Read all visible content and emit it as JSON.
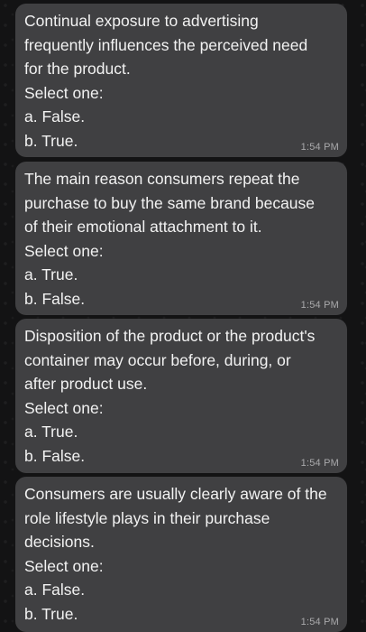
{
  "messages": [
    {
      "question": "Continual exposure to advertising\nfrequently influences the perceived need\nfor the product.",
      "prompt": "Select one:",
      "options": [
        "a. False.",
        "b. True."
      ],
      "time": "1:54 PM"
    },
    {
      "question": "The main reason consumers repeat the\npurchase to buy the same brand because\nof their emotional attachment to it.",
      "prompt": "Select one:",
      "options": [
        "a. True.",
        "b. False."
      ],
      "time": "1:54 PM"
    },
    {
      "question": "Disposition of the product or the product's\ncontainer may occur before, during, or\nafter product use.",
      "prompt": "Select one:",
      "options": [
        "a. True.",
        "b. False."
      ],
      "time": "1:54 PM"
    },
    {
      "question": "Consumers are usually clearly aware of the\nrole lifestyle plays in their purchase\ndecisions.",
      "prompt": "Select one:",
      "options": [
        "a. False.",
        "b. True."
      ],
      "time": "1:54 PM"
    }
  ],
  "colors": {
    "background": "#131314",
    "bubble": "#404042",
    "text": "#f2f2f2",
    "timestamp": "#a9a9ab"
  }
}
